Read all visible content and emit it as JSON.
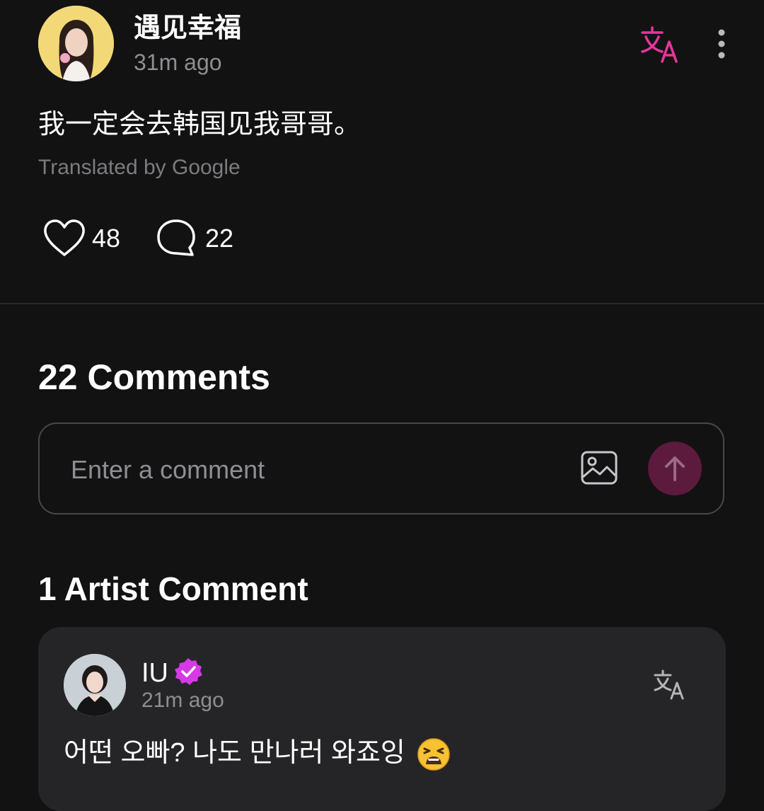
{
  "post": {
    "author": "遇见幸福",
    "time": "31m ago",
    "body": "我一定会去韩国见我哥哥。",
    "translated_by": "Translated by Google",
    "likes": "48",
    "comments": "22"
  },
  "comments_section": {
    "heading": "22 Comments",
    "input_placeholder": "Enter a comment"
  },
  "artist_section": {
    "heading": "1 Artist Comment",
    "comment": {
      "author": "IU",
      "time": "21m ago",
      "text": "어떤 오빠? 나도 만나러 와죠잉",
      "emoji": "😫"
    }
  },
  "colors": {
    "background": "#121212",
    "accent_pink": "#e8359c",
    "verified_purple": "#d63ae6",
    "send_button": "#5c1a3d",
    "card": "#252527"
  },
  "icons": {
    "translate": "translate-icon",
    "more": "more-vertical-icon",
    "like": "heart-icon",
    "comment": "comment-bubble-icon",
    "image": "image-icon",
    "send": "arrow-up-icon",
    "verified": "verified-badge-icon"
  }
}
